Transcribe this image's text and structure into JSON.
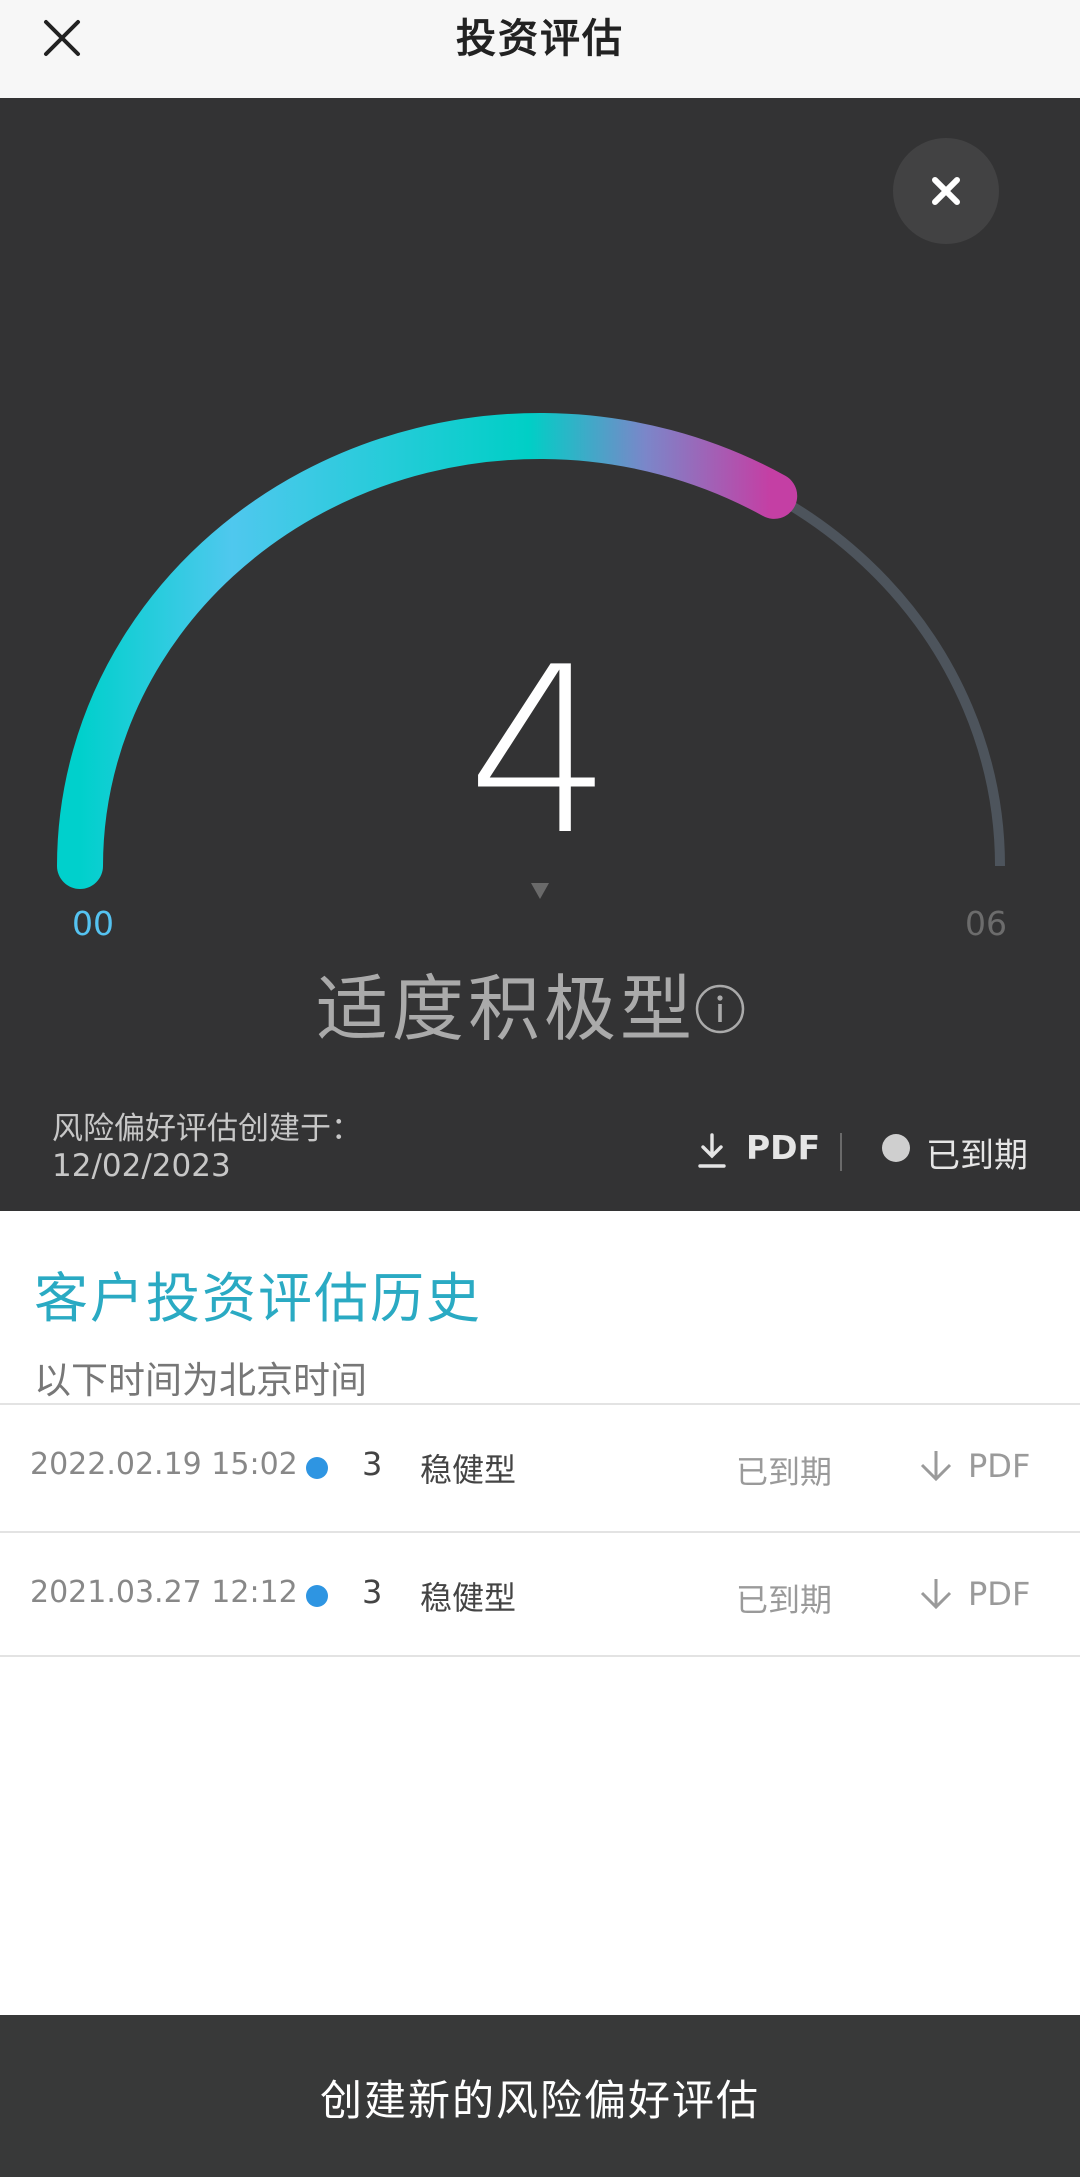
{
  "header": {
    "title": "投资评估",
    "close_icon": "close-icon"
  },
  "assessment": {
    "score": "4",
    "min_label": "00",
    "max_label": "06",
    "risk_type": "适度积极型",
    "created_label": "风险偏好评估创建于：",
    "created_date": "12/02/2023",
    "pdf_label": "PDF",
    "status_label": "已到期",
    "gauge_fill_fraction": 0.67,
    "colors": {
      "gauge_start": "#00d0cc",
      "gauge_mid": "#4fc8ee",
      "gauge_end": "#c43fa4",
      "track": "#4d545c",
      "background": "#333334"
    }
  },
  "history": {
    "title": "客户投资评估历史",
    "subtitle": "以下时间为北京时间",
    "rows": [
      {
        "date": "2022.02.19 15:02",
        "level": "3",
        "type": "稳健型",
        "status": "已到期",
        "pdf": "PDF"
      },
      {
        "date": "2021.03.27 12:12",
        "level": "3",
        "type": "稳健型",
        "status": "已到期",
        "pdf": "PDF"
      }
    ]
  },
  "footer": {
    "create_button": "创建新的风险偏好评估"
  }
}
